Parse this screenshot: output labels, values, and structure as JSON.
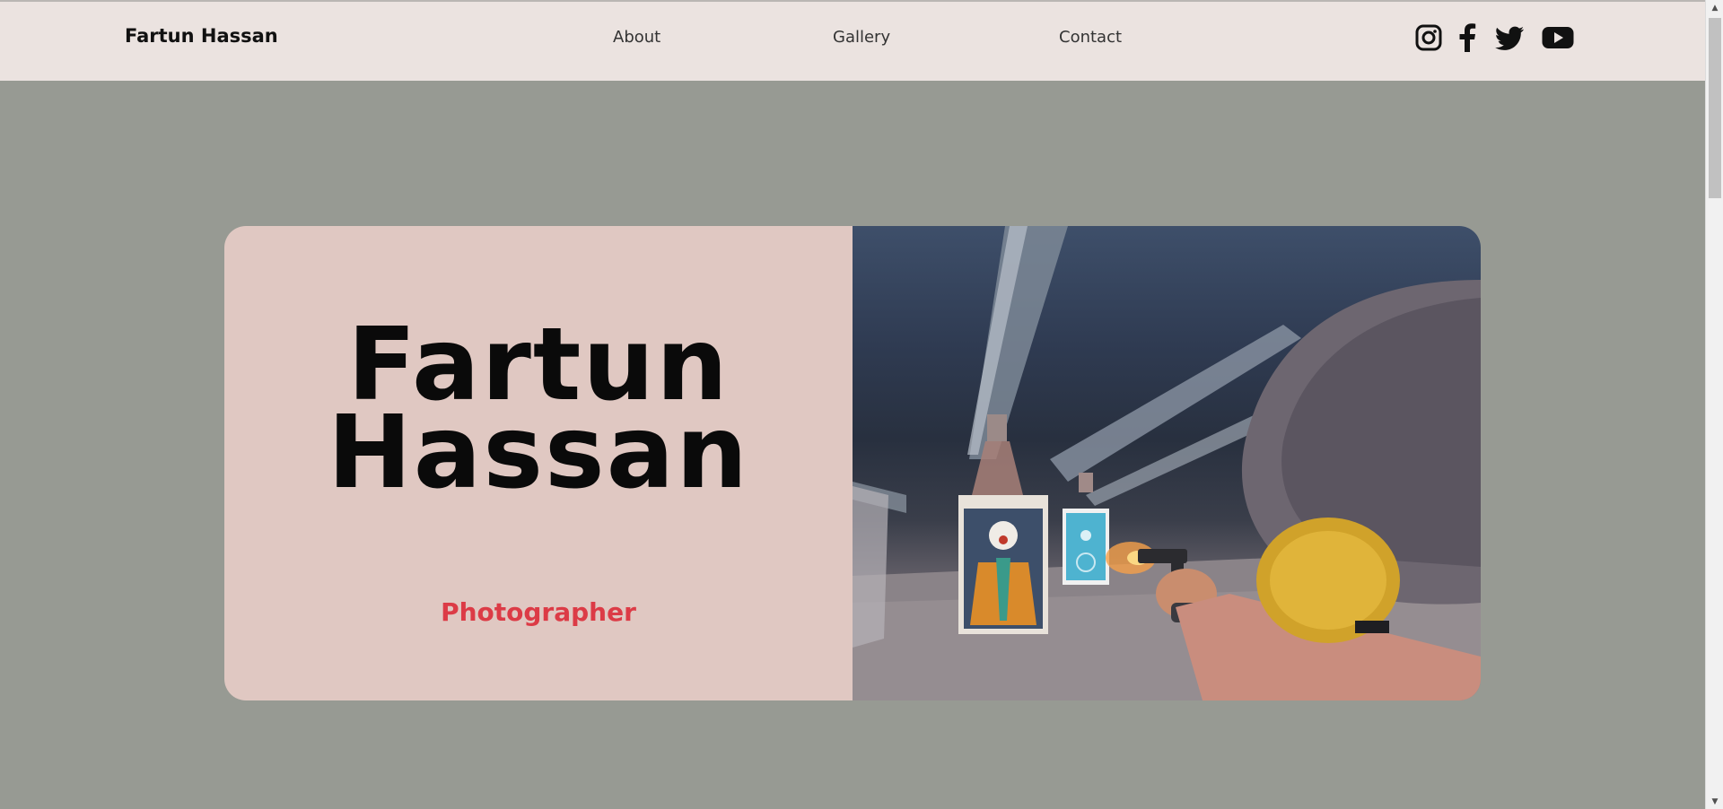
{
  "header": {
    "brand": "Fartun Hassan",
    "nav": [
      "About",
      "Gallery",
      "Contact"
    ],
    "social_icons": [
      "instagram-icon",
      "facebook-icon",
      "twitter-icon",
      "youtube-icon"
    ]
  },
  "hero": {
    "name_line1": "Fartun",
    "name_line2": "Hassan",
    "role": "Photographer"
  },
  "colors": {
    "page_bg": "#979a93",
    "header_bg": "#ebe3e0",
    "card_bg": "#e0c8c2",
    "accent": "#dc3b46"
  }
}
